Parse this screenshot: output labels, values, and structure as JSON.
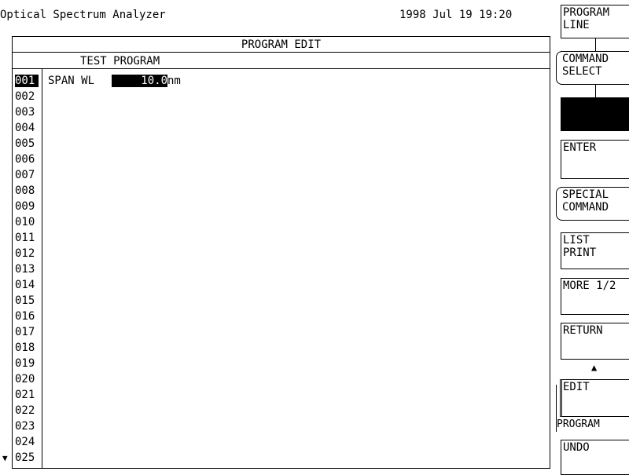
{
  "header": {
    "app_title": "Optical Spectrum Analyzer",
    "datetime": "1998 Jul 19 19:20"
  },
  "editor": {
    "title": "PROGRAM EDIT",
    "program_name": "TEST PROGRAM",
    "selected_line": "001",
    "line_numbers": [
      "001",
      "002",
      "003",
      "004",
      "005",
      "006",
      "007",
      "008",
      "009",
      "010",
      "011",
      "012",
      "013",
      "014",
      "015",
      "016",
      "017",
      "018",
      "019",
      "020",
      "021",
      "022",
      "023",
      "024",
      "025"
    ],
    "command": {
      "name": "SPAN WL",
      "value": "10.0",
      "unit": "nm"
    },
    "scroll_indicator": "▼"
  },
  "softkeys": {
    "program_line": "PROGRAM\nLINE",
    "command_select": "COMMAND\nSELECT",
    "blank": "",
    "enter": "ENTER",
    "special_command": "SPECIAL\nCOMMAND",
    "list_print": "LIST\nPRINT",
    "more": "MORE 1/2",
    "return": "RETURN",
    "up_arrow": "▲",
    "edit": "EDIT",
    "program_tab": "PROGRAM",
    "undo": "UNDO"
  }
}
